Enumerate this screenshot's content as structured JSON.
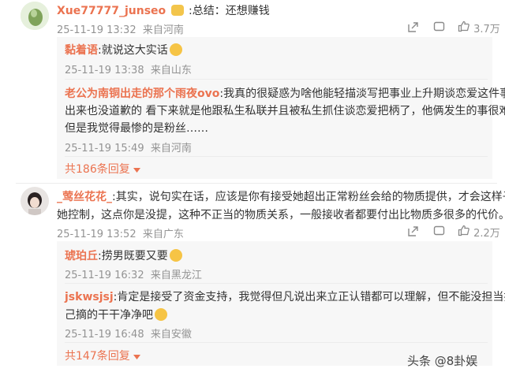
{
  "comments": [
    {
      "username": "Xue77777_junseo",
      "text": ":总结：还想赚钱",
      "date": "25-11-19 13:32",
      "location": "来自河南",
      "likes": "3.7万",
      "replies": [
        {
          "username": "黏着语",
          "text": ":就说这大实话",
          "date": "25-11-19 13:38",
          "location": "来自山东"
        },
        {
          "username": "老公为南铜出走的那个雨夜ovo",
          "text_lines": [
            ":我真的很疑惑为啥他能轻描淡写把事业上升期谈恋爱这件事讲",
            "出来也没道歉的  看下来就是他跟私生私联并且被私生抓住谈恋爱把柄了，他俩发生的事很难评",
            "但是我觉得最惨的是粉丝……"
          ],
          "date": "25-11-19 15:49",
          "location": "来自河南"
        }
      ],
      "more": "共186条回复"
    },
    {
      "username": "_莺丝花花_",
      "text_lines": [
        ":其实，说句实在话，应该是你有接受她超出正常粉丝会给的物质提供，才会这样子受",
        "她控制，这点你是没提，这种不正当的物质关系，一般接收者都要付出比物质多很多的代价。"
      ],
      "date": "25-11-19 13:52",
      "location": "来自广东",
      "likes": "2.2万",
      "replies": [
        {
          "username": "琥珀丘",
          "text": ":捞男既要又要",
          "date": "25-11-19 16:32",
          "location": "来自黑龙江"
        },
        {
          "username": "jskwsjsj",
          "text_lines": [
            ":肯定是接受了资金支持，我觉得但凡说出来立正认错都可以理解，但不能没担当把自",
            "己摘的干干净净吧"
          ],
          "date": "25-11-19 16:48",
          "location": "来自安徽"
        }
      ],
      "more": "共147条回复"
    }
  ],
  "watermark": "头条 @8卦娱",
  "icons": [
    "share-icon",
    "comment-icon",
    "like-icon",
    "chevron-down-icon"
  ],
  "colors": {
    "username": "#eb7350",
    "meta": "#939393",
    "reply_bg": "#f7f7f7"
  }
}
